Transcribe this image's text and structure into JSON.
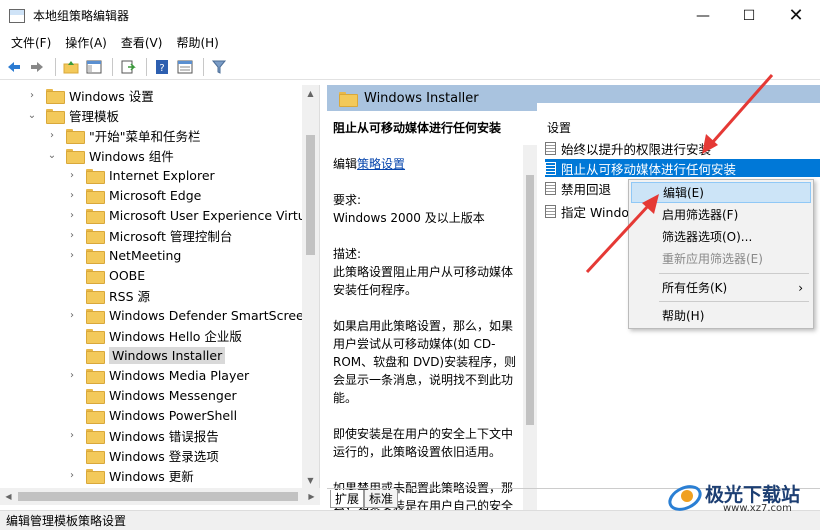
{
  "window": {
    "title": "本地组策略编辑器",
    "minimize": "—",
    "maximize": "☐",
    "close": "✕"
  },
  "menu": [
    "文件(F)",
    "操作(A)",
    "查看(V)",
    "帮助(H)"
  ],
  "tree": [
    {
      "label": "Windows 设置",
      "depth": 1,
      "arrow": "›",
      "selected": false
    },
    {
      "label": "管理模板",
      "depth": 1,
      "arrow": "⌄",
      "selected": false
    },
    {
      "label": "\"开始\"菜单和任务栏",
      "depth": 2,
      "arrow": "›",
      "selected": false
    },
    {
      "label": "Windows 组件",
      "depth": 2,
      "arrow": "⌄",
      "selected": false
    },
    {
      "label": "Internet Explorer",
      "depth": 3,
      "arrow": "›",
      "selected": false
    },
    {
      "label": "Microsoft Edge",
      "depth": 3,
      "arrow": "›",
      "selected": false
    },
    {
      "label": "Microsoft User Experience Virtualiz",
      "depth": 3,
      "arrow": "›",
      "selected": false
    },
    {
      "label": "Microsoft 管理控制台",
      "depth": 3,
      "arrow": "›",
      "selected": false
    },
    {
      "label": "NetMeeting",
      "depth": 3,
      "arrow": "›",
      "selected": false
    },
    {
      "label": "OOBE",
      "depth": 3,
      "arrow": "",
      "selected": false
    },
    {
      "label": "RSS 源",
      "depth": 3,
      "arrow": "",
      "selected": false
    },
    {
      "label": "Windows Defender SmartScreen",
      "depth": 3,
      "arrow": "›",
      "selected": false
    },
    {
      "label": "Windows Hello 企业版",
      "depth": 3,
      "arrow": "",
      "selected": false
    },
    {
      "label": "Windows Installer",
      "depth": 3,
      "arrow": "",
      "selected": true
    },
    {
      "label": "Windows Media Player",
      "depth": 3,
      "arrow": "›",
      "selected": false
    },
    {
      "label": "Windows Messenger",
      "depth": 3,
      "arrow": "",
      "selected": false
    },
    {
      "label": "Windows PowerShell",
      "depth": 3,
      "arrow": "",
      "selected": false
    },
    {
      "label": "Windows 错误报告",
      "depth": 3,
      "arrow": "›",
      "selected": false
    },
    {
      "label": "Windows 登录选项",
      "depth": 3,
      "arrow": "",
      "selected": false
    },
    {
      "label": "Windows 更新",
      "depth": 3,
      "arrow": "›",
      "selected": false
    }
  ],
  "right_header": "Windows Installer",
  "description": {
    "title": "阻止从可移动媒体进行任何安装",
    "edit_prefix": "编辑",
    "edit_link": "策略设置",
    "req_label": "要求:",
    "req_value": "Windows 2000 及以上版本",
    "desc_label": "描述:",
    "desc_text": "此策略设置阻止用户从可移动媒体安装任何程序。",
    "para1": "如果启用此策略设置，那么，如果用户尝试从可移动媒体(如 CD-ROM、软盘和 DVD)安装程序，则会显示一条消息，说明找不到此功能。",
    "para2": "即使安装是在用户的安全上下文中运行的，此策略设置依旧适用。",
    "para3": "如果禁用或未配置此策略设置，那么，如果安装是在用户自己的安全"
  },
  "list": {
    "header": "设置",
    "items": [
      "始终以提升的权限进行安装",
      "阻止从可移动媒体进行任何安装",
      "禁用回退",
      "指定 Windo"
    ]
  },
  "context_menu": {
    "items": [
      {
        "label": "编辑(E)",
        "hover": true,
        "disabled": false
      },
      {
        "label": "启用筛选器(F)",
        "hover": false,
        "disabled": false
      },
      {
        "label": "筛选器选项(O)...",
        "hover": false,
        "disabled": false
      },
      {
        "label": "重新应用筛选器(E)",
        "hover": false,
        "disabled": true
      },
      {
        "label": "所有任务(K)",
        "hover": false,
        "disabled": false,
        "submenu": "›"
      },
      {
        "label": "帮助(H)",
        "hover": false,
        "disabled": false
      }
    ]
  },
  "tabs": [
    "扩展",
    "标准"
  ],
  "status": "编辑管理模板策略设置",
  "watermark": {
    "text": "极光下载站",
    "url": "www.xz7.com"
  },
  "colors": {
    "header_bg": "#a9c3df",
    "selection": "#0078d7",
    "arrow_red": "#e53935"
  }
}
